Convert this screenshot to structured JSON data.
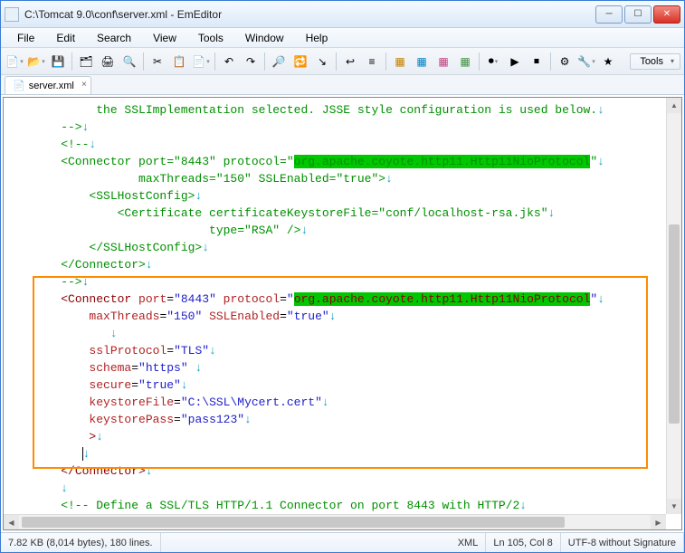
{
  "title": "C:\\Tomcat 9.0\\conf\\server.xml - EmEditor",
  "menu": [
    "File",
    "Edit",
    "Search",
    "View",
    "Tools",
    "Window",
    "Help"
  ],
  "tools_panel_label": "Tools",
  "tab": {
    "label": "server.xml"
  },
  "status": {
    "size": "7.82 KB (8,014 bytes), 180 lines.",
    "lang": "XML",
    "pos": "Ln 105, Col 8",
    "enc": "UTF-8 without Signature"
  },
  "code": {
    "l1": "         the SSLImplementation selected. JSSE style configuration is used below.",
    "l2": "    -->",
    "l3": "    <!--",
    "l4a": "    <Connector port=\"8443\" protocol=\"",
    "l4b": "org.apache.coyote.http11.Http11NioProtocol",
    "l4c": "\"",
    "l5": "               maxThreads=\"150\" SSLEnabled=\"true\">",
    "l6": "        <SSLHostConfig>",
    "l7": "            <Certificate certificateKeystoreFile=\"conf/localhost-rsa.jks\"",
    "l8": "                         type=\"RSA\" />",
    "l9": "        </SSLHostConfig>",
    "l10": "    </Connector>",
    "l11": "    -->",
    "l12_a": "    ",
    "l12_b": "<Connector",
    "l12_c": " port",
    "l12_d": "=",
    "l12_e": "\"8443\"",
    "l12_f": " protocol",
    "l12_g": "=",
    "l12_h": "\"",
    "l12_i": "org.apache.coyote.http11.Http11NioProtocol",
    "l12_j": "\"",
    "l13_a": "        ",
    "l13_b": "maxThreads",
    "l13_c": "=",
    "l13_d": "\"150\"",
    "l13_e": " SSLEnabled",
    "l13_f": "=",
    "l13_g": "\"true\"",
    "l14": "           ",
    "l15_a": "        ",
    "l15_b": "sslProtocol",
    "l15_c": "=",
    "l15_d": "\"TLS\"",
    "l16_a": "        ",
    "l16_b": "schema",
    "l16_c": "=",
    "l16_d": "\"https\"",
    "l16_e": " ",
    "l17_a": "        ",
    "l17_b": "secure",
    "l17_c": "=",
    "l17_d": "\"true\"",
    "l18_a": "        ",
    "l18_b": "keystoreFile",
    "l18_c": "=",
    "l18_d": "\"C:\\SSL\\Mycert.cert\"",
    "l19_a": "        ",
    "l19_b": "keystorePass",
    "l19_c": "=",
    "l19_d": "\"pass123\"",
    "l20_a": "        ",
    "l20_b": ">",
    "l21_a": "       ",
    "l22_a": "    ",
    "l22_b": "</Connector>",
    "l23": "    ",
    "l24": "    <!-- Define a SSL/TLS HTTP/1.1 Connector on port 8443 with HTTP/2"
  }
}
